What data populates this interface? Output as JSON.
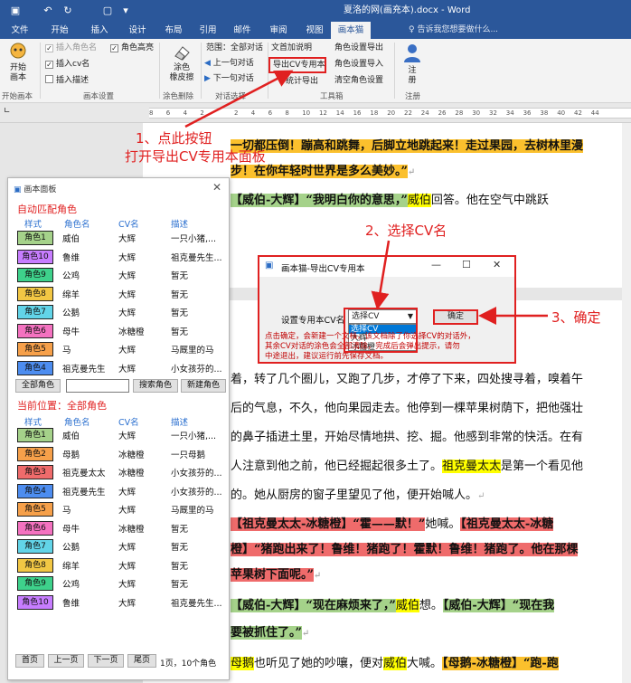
{
  "titlebar": {
    "doc_title": "夏洛的网(画充本).docx - Word",
    "undo_icon": "undo-icon",
    "redo_icon": "redo-icon",
    "save_icon": "save-icon"
  },
  "tabs": [
    "文件",
    "开始",
    "插入",
    "设计",
    "布局",
    "引用",
    "邮件",
    "审阅",
    "视图",
    "画本猫"
  ],
  "active_tab": "画本猫",
  "tell_me": "告诉我您想要做什么...",
  "ribbon": {
    "start_btn": "开始\n画本",
    "start_group": "开始画本",
    "checkboxes": [
      {
        "label": "插入角色名",
        "checked": true,
        "disabled": true
      },
      {
        "label": "插入cv名",
        "checked": true,
        "disabled": false
      },
      {
        "label": "插入描述",
        "checked": false,
        "disabled": false
      },
      {
        "label": "角色高亮",
        "checked": true,
        "disabled": false
      }
    ],
    "settings_group": "画本设置",
    "eraser_btn": "涂色\n橡皮擦",
    "erase_group": "涂色删除",
    "range": "范围：全部对话",
    "prev": "上一句对话",
    "next": "下一句对话",
    "dialog_group": "对话选择",
    "doc_help": "文首加说明",
    "export_cv": "导出CV专用本",
    "stats_export": "统计导出",
    "role_export": "角色设置导出",
    "role_import": "角色设置导入",
    "role_clear": "清空角色设置",
    "tools_group": "工具箱",
    "register": "注\n册",
    "register_group": "注册"
  },
  "ruler_numbers": [
    "8",
    "6",
    "4",
    "2",
    "",
    "2",
    "4",
    "6",
    "8",
    "10",
    "12",
    "14",
    "16",
    "18",
    "20",
    "22",
    "24",
    "26",
    "28",
    "30",
    "32",
    "34",
    "36",
    "38",
    "40",
    "42",
    "44"
  ],
  "document": {
    "lines": [
      "一切都压倒！蹦高和跳舞，后脚立地跳起来！走过果园，去树林里漫",
      "步！在你年轻时世界是多么美妙。”",
      "【威伯-大辉】“我明白你的意思，”威伯回答。他在空气中跳跃",
      "着，转了几个圈儿，又跑了几步，才停了下来，四处搜寻着，嗅着午",
      "后的气息，不久，他向果园走去。他停到一棵苹果树荫下，把他强壮",
      "的鼻子插进土里，开始尽情地拱、挖、掘。他感到非常的快活。在有",
      "人注意到他之前，他已经掘起很多土了。祖克曼太太是第一个看见他",
      "的。她从厨房的窗子里望见了他，便开始喊人。",
      "【祖克曼太太-冰糖橙】“霍——默！”她喊。【祖克曼太太-冰糖",
      "橙】“猪跑出来了！鲁维！猪跑了！霍默！鲁维！猪跑了。他在那棵",
      "苹果树下面呢。”",
      "【威伯-大辉】“现在麻烦来了，”威伯想。【威伯-大辉】“现在我",
      "要被抓住了。”",
      "母鹅也听见了她的吵嚷，便对威伯大喊。【母鹅-冰糖橙】“跑-跑"
    ]
  },
  "panel": {
    "title": "画本面板",
    "close_icon": "close-icon",
    "auto_section": "自动匹配角色",
    "headers": [
      "样式",
      "角色名",
      "CV名",
      "描述"
    ],
    "auto_rows": [
      {
        "style": "角色1",
        "color": "#a5d28a",
        "name": "威伯",
        "cv": "大辉",
        "desc": "一只小猪,..."
      },
      {
        "style": "角色10",
        "color": "#c77dff",
        "name": "鲁维",
        "cv": "大辉",
        "desc": "祖克曼先生..."
      },
      {
        "style": "角色9",
        "color": "#3ed18b",
        "name": "公鸡",
        "cv": "大辉",
        "desc": "暂无"
      },
      {
        "style": "角色8",
        "color": "#f2c744",
        "name": "绵羊",
        "cv": "大辉",
        "desc": "暂无"
      },
      {
        "style": "角色7",
        "color": "#62d4e8",
        "name": "公鹅",
        "cv": "大辉",
        "desc": "暂无"
      },
      {
        "style": "角色6",
        "color": "#f472c0",
        "name": "母牛",
        "cv": "冰糖橙",
        "desc": "暂无"
      },
      {
        "style": "角色5",
        "color": "#f6a04a",
        "name": "马",
        "cv": "大辉",
        "desc": "马厩里的马"
      },
      {
        "style": "角色4",
        "color": "#4d8df0",
        "name": "祖克曼先生",
        "cv": "大辉",
        "desc": "小女孩芬的..."
      }
    ],
    "all_roles_btn": "全部角色",
    "search_btn": "搜索角色",
    "new_btn": "新建角色",
    "current_section": "当前位置：全部角色",
    "all_rows": [
      {
        "style": "角色1",
        "color": "#a5d28a",
        "name": "威伯",
        "cv": "大辉",
        "desc": "一只小猪,..."
      },
      {
        "style": "角色2",
        "color": "#f6a04a",
        "name": "母鹅",
        "cv": "冰糖橙",
        "desc": "一只母鹅"
      },
      {
        "style": "角色3",
        "color": "#ef6b6b",
        "name": "祖克曼太太",
        "cv": "冰糖橙",
        "desc": "小女孩芬的..."
      },
      {
        "style": "角色4",
        "color": "#4d8df0",
        "name": "祖克曼先生",
        "cv": "大辉",
        "desc": "小女孩芬的..."
      },
      {
        "style": "角色5",
        "color": "#f6a04a",
        "name": "马",
        "cv": "大辉",
        "desc": "马厩里的马"
      },
      {
        "style": "角色6",
        "color": "#f472c0",
        "name": "母牛",
        "cv": "冰糖橙",
        "desc": "暂无"
      },
      {
        "style": "角色7",
        "color": "#62d4e8",
        "name": "公鹅",
        "cv": "大辉",
        "desc": "暂无"
      },
      {
        "style": "角色8",
        "color": "#f2c744",
        "name": "绵羊",
        "cv": "大辉",
        "desc": "暂无"
      },
      {
        "style": "角色9",
        "color": "#3ed18b",
        "name": "公鸡",
        "cv": "大辉",
        "desc": "暂无"
      },
      {
        "style": "角色10",
        "color": "#c77dff",
        "name": "鲁维",
        "cv": "大辉",
        "desc": "祖克曼先生..."
      }
    ],
    "first_btn": "首页",
    "prev_btn": "上一页",
    "next_btn": "下一页",
    "last_btn": "尾页",
    "page_info": "1页，10个角色"
  },
  "dialog": {
    "title": "画本猫-导出CV专用本",
    "label": "设置专用本CV名",
    "selected": "选择CV",
    "options": [
      "选择CV",
      "大辉",
      "冰糖橙"
    ],
    "ok": "确定",
    "warning_lines": [
      "点击确定，会新建一个文档，该文档除了你选择CV的对话外，",
      "其余CV对话的涂色会全部清除，完成后会弹出提示，请勿",
      "中途退出，建议运行前先保存文档。"
    ]
  },
  "annotations": {
    "step1_line1": "1、点此按钮",
    "step1_line2": "打开导出CV专用本面板",
    "step2": "2、选择CV名",
    "step3": "3、确定"
  }
}
